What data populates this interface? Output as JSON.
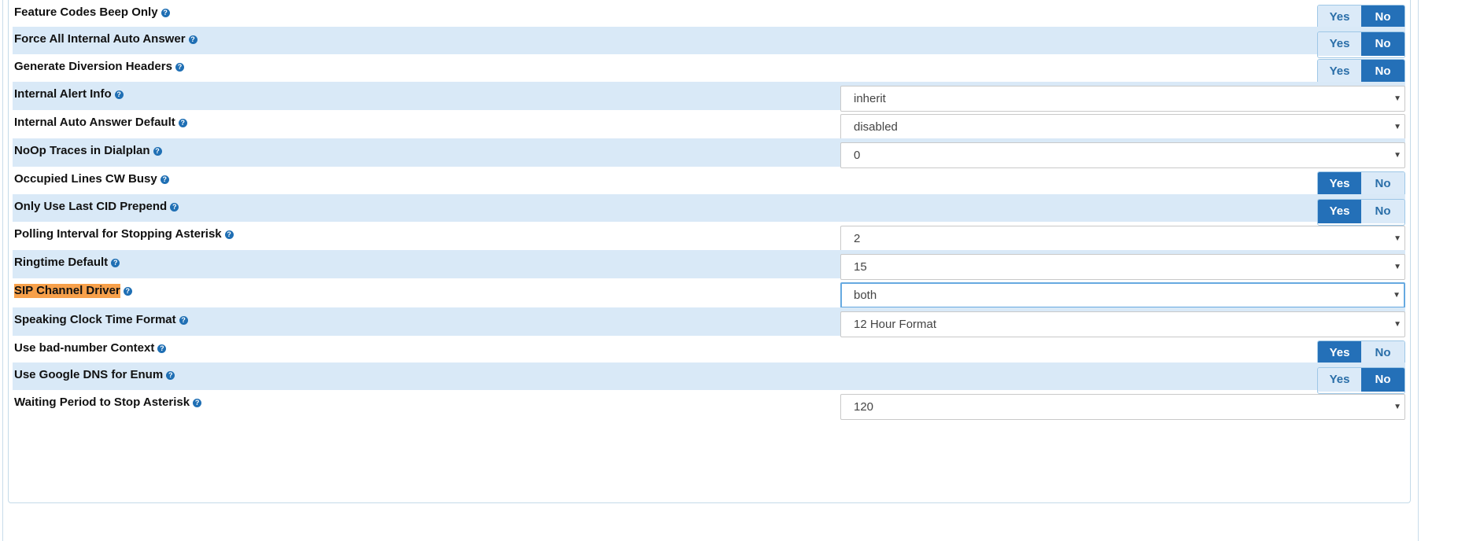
{
  "settings": [
    {
      "label": "Feature Codes Beep Only",
      "type": "toggle",
      "yes": "Yes",
      "no": "No",
      "value": "No"
    },
    {
      "label": "Force All Internal Auto Answer",
      "type": "toggle",
      "yes": "Yes",
      "no": "No",
      "value": "No"
    },
    {
      "label": "Generate Diversion Headers",
      "type": "toggle",
      "yes": "Yes",
      "no": "No",
      "value": "No"
    },
    {
      "label": "Internal Alert Info",
      "type": "select",
      "value": "inherit"
    },
    {
      "label": "Internal Auto Answer Default",
      "type": "select",
      "value": "disabled"
    },
    {
      "label": "NoOp Traces in Dialplan",
      "type": "select",
      "value": "0"
    },
    {
      "label": "Occupied Lines CW Busy",
      "type": "toggle",
      "yes": "Yes",
      "no": "No",
      "value": "Yes"
    },
    {
      "label": "Only Use Last CID Prepend",
      "type": "toggle",
      "yes": "Yes",
      "no": "No",
      "value": "Yes"
    },
    {
      "label": "Polling Interval for Stopping Asterisk",
      "type": "select",
      "value": "2"
    },
    {
      "label": "Ringtime Default",
      "type": "select",
      "value": "15"
    },
    {
      "label": "SIP Channel Driver",
      "type": "select",
      "value": "both",
      "highlighted": true,
      "focused": true
    },
    {
      "label": "Speaking Clock Time Format",
      "type": "select",
      "value": "12 Hour Format"
    },
    {
      "label": "Use bad-number Context",
      "type": "toggle",
      "yes": "Yes",
      "no": "No",
      "value": "Yes"
    },
    {
      "label": "Use Google DNS for Enum",
      "type": "toggle",
      "yes": "Yes",
      "no": "No",
      "value": "No"
    },
    {
      "label": "Waiting Period to Stop Asterisk",
      "type": "select",
      "value": "120"
    }
  ],
  "icons": {
    "help": "question-circle-icon",
    "caret": "caret-down-icon"
  },
  "colors": {
    "accent": "#2470b8",
    "row_alt": "#d9e9f7",
    "highlight": "#f7a04a",
    "help": "#1f6fb4"
  }
}
